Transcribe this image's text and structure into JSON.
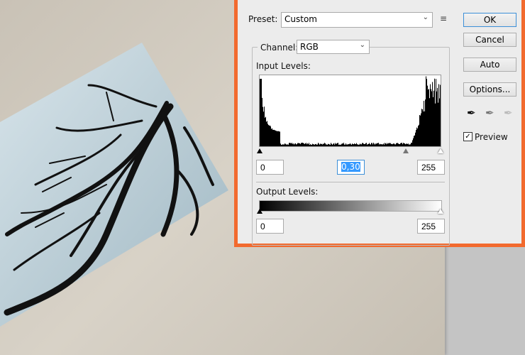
{
  "dialog": {
    "preset_label": "Preset:",
    "preset_value": "Custom",
    "preset_menu_icon": "list-menu-icon",
    "channel_label": "Channel:",
    "channel_value": "RGB",
    "input_levels_label": "Input Levels:",
    "input_black": "0",
    "input_gamma": "0,30",
    "input_white": "255",
    "output_levels_label": "Output Levels:",
    "output_black": "0",
    "output_white": "255",
    "buttons": {
      "ok": "OK",
      "cancel": "Cancel",
      "auto": "Auto",
      "options": "Options..."
    },
    "eyedroppers": [
      "black-point-eyedropper-icon",
      "gray-point-eyedropper-icon",
      "white-point-eyedropper-icon"
    ],
    "preview_label": "Preview",
    "preview_checked": true
  },
  "colors": {
    "highlight_border": "#f26a2e",
    "selection": "#3399ff"
  }
}
